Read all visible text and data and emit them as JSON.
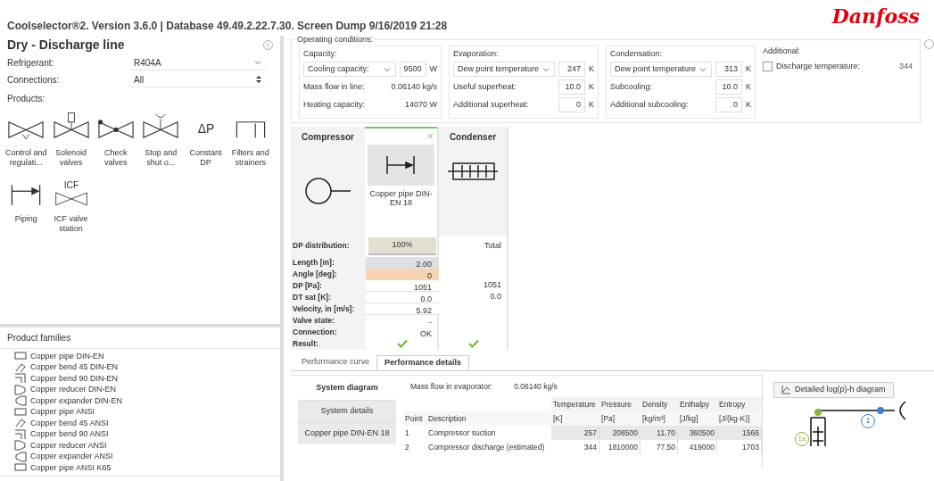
{
  "title": "Coolselector®2. Version 3.6.0 | Database 49.49.2.22.7.30. Screen Dump 9/16/2019 21:28",
  "logo": "Danfoss",
  "left_panel": {
    "heading": "Dry - Discharge line",
    "fields": [
      {
        "label": "Refrigerant:",
        "value": "R404A",
        "kind": "dropdown"
      },
      {
        "label": "Connections:",
        "value": "All",
        "kind": "spinner"
      }
    ],
    "products_label": "Products:",
    "products": [
      {
        "label": "Control and regulati...",
        "kind": "control"
      },
      {
        "label": "Solenoid valves",
        "kind": "solenoid"
      },
      {
        "label": "Check valves",
        "kind": "check"
      },
      {
        "label": "Stop and shut o...",
        "kind": "stop"
      },
      {
        "label": "Constant DP",
        "kind": "dp",
        "symbol": "ΔP"
      },
      {
        "label": "Filters and strainers",
        "kind": "filter"
      },
      {
        "label": "Piping",
        "kind": "piping"
      },
      {
        "label": "ICF valve station",
        "kind": "icf",
        "symbol": "ICF"
      }
    ],
    "families_label": "Product families",
    "families": [
      {
        "label": "Copper pipe DIN-EN",
        "kind": "pipe"
      },
      {
        "label": "Copper bend 45 DIN-EN",
        "kind": "bend45"
      },
      {
        "label": "Copper bend 90 DIN-EN",
        "kind": "bend90"
      },
      {
        "label": "Copper reducer DIN-EN",
        "kind": "reducer"
      },
      {
        "label": "Copper expander DIN-EN",
        "kind": "expander"
      },
      {
        "label": "Copper pipe ANSI",
        "kind": "pipe"
      },
      {
        "label": "Copper bend 45 ANSI",
        "kind": "bend45"
      },
      {
        "label": "Copper bend 90 ANSI",
        "kind": "bend90"
      },
      {
        "label": "Copper reducer ANSI",
        "kind": "reducer"
      },
      {
        "label": "Copper expander ANSI",
        "kind": "expander"
      },
      {
        "label": "Copper pipe ANSI K65",
        "kind": "pipe"
      }
    ]
  },
  "operating_conditions": {
    "title": "Operating conditions:",
    "groups": [
      {
        "title": "Capacity:",
        "select": "Cooling capacity:",
        "value": "9500",
        "unit": "W",
        "rows": [
          {
            "label": "Mass flow in line:",
            "value": "0.06140 kg/s",
            "kind": "text"
          },
          {
            "label": "Heating capacity:",
            "value": "14070 W",
            "kind": "text"
          }
        ]
      },
      {
        "title": "Evaporation:",
        "select": "Dew point temperature",
        "value": "247",
        "unit": "K",
        "rows": [
          {
            "label": "Useful superheat:",
            "value": "10.0",
            "unit": "K",
            "kind": "input"
          },
          {
            "label": "Additional superheat:",
            "value": "0",
            "unit": "K",
            "kind": "input"
          }
        ]
      },
      {
        "title": "Condensation:",
        "select": "Dew point temperature",
        "value": "313",
        "unit": "K",
        "rows": [
          {
            "label": "Subcooling:",
            "value": "10.0",
            "unit": "K",
            "kind": "input"
          },
          {
            "label": "Additional subcooling:",
            "value": "0",
            "unit": "K",
            "kind": "input"
          }
        ]
      }
    ],
    "additional": {
      "title": "Additional:",
      "label": "Discharge temperature:",
      "checked": false,
      "value": "344"
    }
  },
  "components": {
    "compressor": "Compressor",
    "close": "×",
    "pipe": "Copper pipe DIN-EN 18",
    "condenser": "Condenser",
    "rows": [
      {
        "label": "DP distribution:",
        "kind": "button",
        "value": "100%",
        "total": "Total"
      },
      {
        "label": "Length [m]:",
        "kind": "input",
        "value": "2.00",
        "color": "#dde1e6"
      },
      {
        "label": "Angle [deg]:",
        "kind": "input",
        "value": "0",
        "color": "#f8d4b4"
      },
      {
        "label": "DP [Pa]:",
        "kind": "text",
        "value": "1051",
        "total": "1051"
      },
      {
        "label": "DT sat [K]:",
        "kind": "text",
        "value": "0.0",
        "total": "0.0"
      },
      {
        "label": "Velocity, in [m/s]:",
        "kind": "text",
        "value": "5.92"
      },
      {
        "label": "Valve state:",
        "kind": "plain",
        "value": "-"
      },
      {
        "label": "Connection:",
        "kind": "plain",
        "value": "OK"
      },
      {
        "label": "Result:",
        "kind": "result",
        "passed": true,
        "total_passed": true
      }
    ]
  },
  "tabs": [
    {
      "label": "Performance curve",
      "selected": false
    },
    {
      "label": "Performance details",
      "selected": true
    }
  ],
  "side_tabs": [
    {
      "label": "System diagram",
      "selected": true
    },
    {
      "label": "System details",
      "selected": false
    },
    {
      "label": "Copper pipe DIN-EN 18",
      "selected": false
    }
  ],
  "details": {
    "mass_flow_label": "Mass flow in evaporator:",
    "mass_flow": "0.06140 kg/s",
    "columns": [
      {
        "name": "Point"
      },
      {
        "name": "Description"
      },
      {
        "name": "Temperature",
        "unit": "[K]"
      },
      {
        "name": "Pressure",
        "unit": "[Pa]"
      },
      {
        "name": "Density",
        "unit": "[kg/m³]"
      },
      {
        "name": "Enthalpy",
        "unit": "[J/kg]"
      },
      {
        "name": "Entropy",
        "unit": "[J/(kg·K)]"
      }
    ],
    "rows": [
      [
        "1",
        "Compressor suction",
        "257",
        "208500",
        "11.70",
        "360500",
        "1566"
      ],
      [
        "2",
        "Compressor discharge (estimated)",
        "344",
        "1810000",
        "77.50",
        "419000",
        "1703"
      ]
    ],
    "diagram_button": "Detailed log(p)-h diagram",
    "points": [
      {
        "label": "1a",
        "color": "#8db33c"
      },
      {
        "label": "1",
        "color": "#3a7fd0"
      }
    ]
  }
}
